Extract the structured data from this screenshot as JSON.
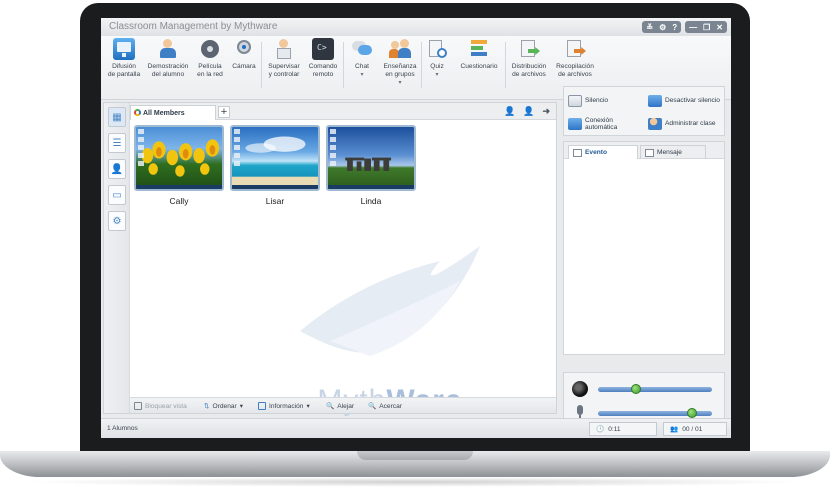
{
  "app": {
    "title": "Classroom Management by Mythware",
    "window_controls": [
      "≚",
      "⚙",
      "?",
      "—",
      "❐",
      "✕"
    ]
  },
  "toolbar": {
    "items": [
      {
        "label": "Difusión\nde pantalla",
        "icon": "screen-broadcast-icon"
      },
      {
        "label": "Demostración\ndel alumno",
        "icon": "student-demo-icon"
      },
      {
        "label": "Película\nen la red",
        "icon": "network-movie-icon"
      },
      {
        "label": "Cámara",
        "icon": "camera-icon"
      },
      {
        "label": "Supervisar\ny controlar",
        "icon": "monitor-control-icon"
      },
      {
        "label": "Comando\nremoto",
        "icon": "remote-command-icon"
      },
      {
        "label": "Chat",
        "icon": "chat-icon"
      },
      {
        "label": "Enseñanza\nen grupos",
        "icon": "group-teaching-icon"
      },
      {
        "label": "Quiz",
        "icon": "quiz-icon"
      },
      {
        "label": "Cuestionario",
        "icon": "survey-icon"
      },
      {
        "label": "Distribución\nde archivos",
        "icon": "file-distribution-icon"
      },
      {
        "label": "Recopilación\nde archivos",
        "icon": "file-collection-icon"
      }
    ]
  },
  "members_tab": {
    "label": "All Members",
    "add_label": "+"
  },
  "students": [
    {
      "name": "Cally",
      "wallpaper": "tulips"
    },
    {
      "name": "Lisar",
      "wallpaper": "beach"
    },
    {
      "name": "Linda",
      "wallpaper": "stonehenge"
    }
  ],
  "watermark": {
    "part1": "Myth",
    "part2": "Ware"
  },
  "bottom_bar": {
    "lock_view": "Bloquear vista",
    "sort": "Ordenar",
    "info": "Información",
    "zoom_out": "Alejar",
    "zoom_in": "Acercar"
  },
  "right_panel": {
    "silence": "Silencio",
    "unsilence": "Desactivar silencio",
    "auto_connect": "Conexión\nautomática",
    "manage_class": "Administrar clase",
    "tab_event": "Evento",
    "tab_message": "Mensaje"
  },
  "media": {
    "speaker_level": 0.32,
    "mic_level": 0.86
  },
  "status": {
    "students": "1 Alumnos",
    "timer": "0:11",
    "online": "00 / 01"
  },
  "colors": {
    "accent": "#4a86c5",
    "knob": "#3a9b2b",
    "titlebar_text": "#8a8f96"
  }
}
